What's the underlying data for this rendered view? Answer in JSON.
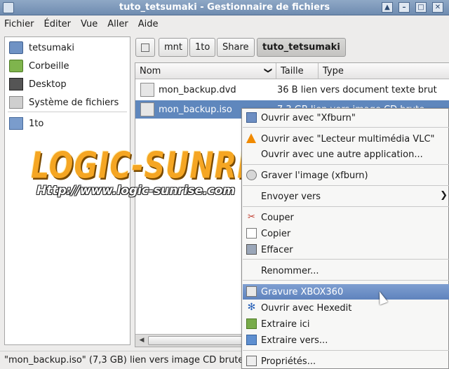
{
  "window": {
    "title": "tuto_tetsumaki - Gestionnaire de fichiers",
    "controls": [
      "▲",
      "–",
      "□",
      "✕"
    ]
  },
  "menubar": {
    "items": [
      {
        "label": "Fichier"
      },
      {
        "label": "Éditer"
      },
      {
        "label": "Vue"
      },
      {
        "label": "Aller"
      },
      {
        "label": "Aide"
      }
    ]
  },
  "sidebar": {
    "items": [
      {
        "label": "tetsumaki",
        "icon": "home-folder-icon"
      },
      {
        "label": "Corbeille",
        "icon": "trash-icon"
      },
      {
        "label": "Desktop",
        "icon": "desktop-icon"
      },
      {
        "label": "Système de fichiers",
        "icon": "filesystem-icon"
      },
      {
        "label": "1to",
        "icon": "folder-icon"
      }
    ]
  },
  "pathbar": {
    "buttons": [
      {
        "label": "mnt"
      },
      {
        "label": "1to"
      },
      {
        "label": "Share"
      },
      {
        "label": "tuto_tetsumaki",
        "active": true
      }
    ]
  },
  "filelist": {
    "columns": [
      {
        "label": "Nom",
        "sort_arrow": "❯"
      },
      {
        "label": "Taille"
      },
      {
        "label": "Type"
      }
    ],
    "rows": [
      {
        "name": "mon_backup.dvd",
        "size_type": "36 B lien vers document texte brut",
        "selected": false
      },
      {
        "name": "mon_backup.iso",
        "size_type": "7,3 GB lien vers image CD brute",
        "selected": true
      }
    ]
  },
  "watermark": {
    "title": "LOGIC-SUNRISE",
    "url": "Http://www.logic-sunrise.com"
  },
  "statusbar": {
    "text": "\"mon_backup.iso\" (7,3 GB) lien vers image CD brute"
  },
  "context_menu": {
    "items": [
      {
        "label": "Ouvrir avec \"Xfburn\"",
        "icon": "xfburn-icon"
      },
      {
        "label": "Ouvrir avec \"Lecteur multimédia VLC\"",
        "icon": "vlc-icon"
      },
      {
        "label": "Ouvrir avec une autre application...",
        "icon": ""
      },
      {
        "label": "Graver l'image (xfburn)",
        "icon": "disc-icon"
      },
      {
        "label": "Envoyer vers",
        "icon": "",
        "submenu_arrow": "❯"
      },
      {
        "label": "Couper",
        "icon": "scissors-icon"
      },
      {
        "label": "Copier",
        "icon": "copy-icon"
      },
      {
        "label": "Effacer",
        "icon": "delete-icon"
      },
      {
        "label": "Renommer...",
        "icon": ""
      },
      {
        "label": "Gravure XBOX360",
        "icon": "drive-icon",
        "highlighted": true
      },
      {
        "label": "Ouvrir avec Hexedit",
        "icon": "gear-icon"
      },
      {
        "label": "Extraire ici",
        "icon": "archive-icon"
      },
      {
        "label": "Extraire vers...",
        "icon": "archive-globe-icon"
      },
      {
        "label": "Propriétés...",
        "icon": "properties-icon"
      }
    ]
  }
}
